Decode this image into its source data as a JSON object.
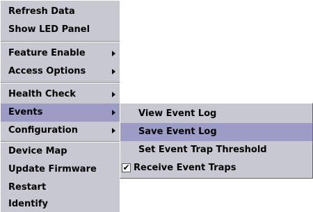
{
  "main_menu": {
    "groups": [
      {
        "items": [
          {
            "label": "Refresh Data"
          },
          {
            "label": "Show LED Panel"
          }
        ]
      },
      {
        "items": [
          {
            "label": "Feature Enable",
            "has_submenu": true
          },
          {
            "label": "Access Options",
            "has_submenu": true
          }
        ]
      },
      {
        "items": [
          {
            "label": "Health Check",
            "has_submenu": true
          },
          {
            "label": "Events",
            "has_submenu": true,
            "highlighted": true
          },
          {
            "label": "Configuration",
            "has_submenu": true
          }
        ]
      },
      {
        "items": [
          {
            "label": "Device Map"
          },
          {
            "label": "Update Firmware"
          },
          {
            "label": "Restart"
          },
          {
            "label": "Identify"
          }
        ]
      }
    ]
  },
  "events_submenu": {
    "items": [
      {
        "label": "View Event Log"
      },
      {
        "label": "Save Event Log",
        "highlighted": true
      },
      {
        "label": "Set Event Trap Threshold"
      },
      {
        "label": "Receive Event Traps",
        "checkbox": true,
        "checked": true,
        "check_glyph": "✔"
      }
    ]
  },
  "colors": {
    "menu_background": "#c8c8d2",
    "highlight": "#9c9cc6",
    "text": "#000000"
  }
}
